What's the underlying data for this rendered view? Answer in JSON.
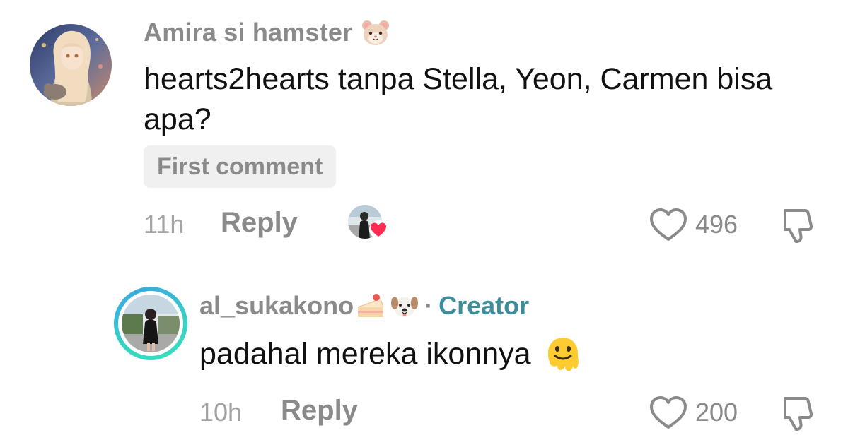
{
  "comments": [
    {
      "username": "Amira si hamster",
      "username_emoji": "hamster-face-emoji",
      "text": "hearts2hearts tanpa Stella, Yeon, Carmen bisa apa?",
      "badge": "First comment",
      "time": "11h",
      "reply_label": "Reply",
      "likes": "496",
      "liked_by_creator": true
    }
  ],
  "reply": {
    "username": "al_sukakono",
    "username_emojis": [
      "shortcake-emoji",
      "dog-face-emoji"
    ],
    "separator": "·",
    "role": "Creator",
    "text": "padahal mereka ikonnya",
    "text_emoji": "melting-face-emoji",
    "time": "10h",
    "reply_label": "Reply",
    "likes": "200"
  },
  "colors": {
    "text_primary": "#111111",
    "text_secondary": "#8a8a8a",
    "creator_accent": "#3d8e9a",
    "heart_red": "#fe2c55",
    "badge_bg": "#f0f0f0"
  }
}
